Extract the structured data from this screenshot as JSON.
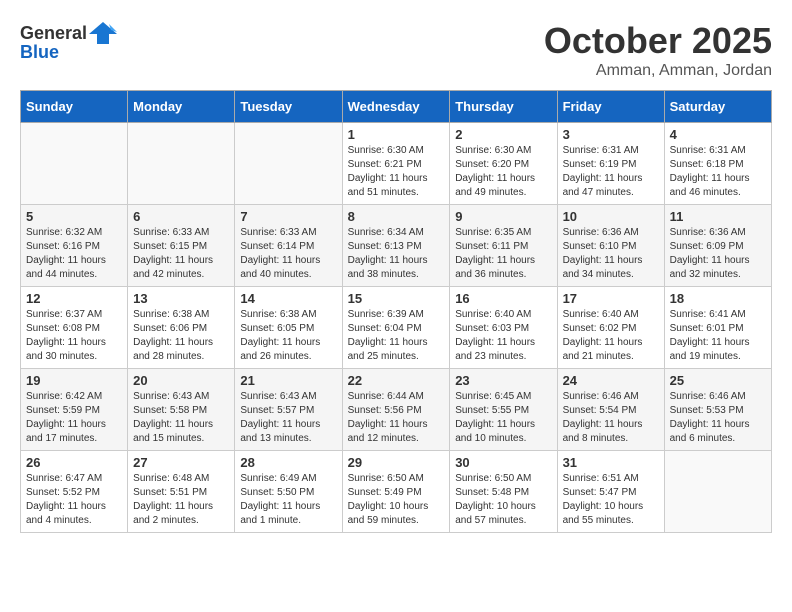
{
  "header": {
    "logo_general": "General",
    "logo_blue": "Blue",
    "month": "October 2025",
    "location": "Amman, Amman, Jordan"
  },
  "weekdays": [
    "Sunday",
    "Monday",
    "Tuesday",
    "Wednesday",
    "Thursday",
    "Friday",
    "Saturday"
  ],
  "weeks": [
    [
      {
        "day": "",
        "info": ""
      },
      {
        "day": "",
        "info": ""
      },
      {
        "day": "",
        "info": ""
      },
      {
        "day": "1",
        "info": "Sunrise: 6:30 AM\nSunset: 6:21 PM\nDaylight: 11 hours\nand 51 minutes."
      },
      {
        "day": "2",
        "info": "Sunrise: 6:30 AM\nSunset: 6:20 PM\nDaylight: 11 hours\nand 49 minutes."
      },
      {
        "day": "3",
        "info": "Sunrise: 6:31 AM\nSunset: 6:19 PM\nDaylight: 11 hours\nand 47 minutes."
      },
      {
        "day": "4",
        "info": "Sunrise: 6:31 AM\nSunset: 6:18 PM\nDaylight: 11 hours\nand 46 minutes."
      }
    ],
    [
      {
        "day": "5",
        "info": "Sunrise: 6:32 AM\nSunset: 6:16 PM\nDaylight: 11 hours\nand 44 minutes."
      },
      {
        "day": "6",
        "info": "Sunrise: 6:33 AM\nSunset: 6:15 PM\nDaylight: 11 hours\nand 42 minutes."
      },
      {
        "day": "7",
        "info": "Sunrise: 6:33 AM\nSunset: 6:14 PM\nDaylight: 11 hours\nand 40 minutes."
      },
      {
        "day": "8",
        "info": "Sunrise: 6:34 AM\nSunset: 6:13 PM\nDaylight: 11 hours\nand 38 minutes."
      },
      {
        "day": "9",
        "info": "Sunrise: 6:35 AM\nSunset: 6:11 PM\nDaylight: 11 hours\nand 36 minutes."
      },
      {
        "day": "10",
        "info": "Sunrise: 6:36 AM\nSunset: 6:10 PM\nDaylight: 11 hours\nand 34 minutes."
      },
      {
        "day": "11",
        "info": "Sunrise: 6:36 AM\nSunset: 6:09 PM\nDaylight: 11 hours\nand 32 minutes."
      }
    ],
    [
      {
        "day": "12",
        "info": "Sunrise: 6:37 AM\nSunset: 6:08 PM\nDaylight: 11 hours\nand 30 minutes."
      },
      {
        "day": "13",
        "info": "Sunrise: 6:38 AM\nSunset: 6:06 PM\nDaylight: 11 hours\nand 28 minutes."
      },
      {
        "day": "14",
        "info": "Sunrise: 6:38 AM\nSunset: 6:05 PM\nDaylight: 11 hours\nand 26 minutes."
      },
      {
        "day": "15",
        "info": "Sunrise: 6:39 AM\nSunset: 6:04 PM\nDaylight: 11 hours\nand 25 minutes."
      },
      {
        "day": "16",
        "info": "Sunrise: 6:40 AM\nSunset: 6:03 PM\nDaylight: 11 hours\nand 23 minutes."
      },
      {
        "day": "17",
        "info": "Sunrise: 6:40 AM\nSunset: 6:02 PM\nDaylight: 11 hours\nand 21 minutes."
      },
      {
        "day": "18",
        "info": "Sunrise: 6:41 AM\nSunset: 6:01 PM\nDaylight: 11 hours\nand 19 minutes."
      }
    ],
    [
      {
        "day": "19",
        "info": "Sunrise: 6:42 AM\nSunset: 5:59 PM\nDaylight: 11 hours\nand 17 minutes."
      },
      {
        "day": "20",
        "info": "Sunrise: 6:43 AM\nSunset: 5:58 PM\nDaylight: 11 hours\nand 15 minutes."
      },
      {
        "day": "21",
        "info": "Sunrise: 6:43 AM\nSunset: 5:57 PM\nDaylight: 11 hours\nand 13 minutes."
      },
      {
        "day": "22",
        "info": "Sunrise: 6:44 AM\nSunset: 5:56 PM\nDaylight: 11 hours\nand 12 minutes."
      },
      {
        "day": "23",
        "info": "Sunrise: 6:45 AM\nSunset: 5:55 PM\nDaylight: 11 hours\nand 10 minutes."
      },
      {
        "day": "24",
        "info": "Sunrise: 6:46 AM\nSunset: 5:54 PM\nDaylight: 11 hours\nand 8 minutes."
      },
      {
        "day": "25",
        "info": "Sunrise: 6:46 AM\nSunset: 5:53 PM\nDaylight: 11 hours\nand 6 minutes."
      }
    ],
    [
      {
        "day": "26",
        "info": "Sunrise: 6:47 AM\nSunset: 5:52 PM\nDaylight: 11 hours\nand 4 minutes."
      },
      {
        "day": "27",
        "info": "Sunrise: 6:48 AM\nSunset: 5:51 PM\nDaylight: 11 hours\nand 2 minutes."
      },
      {
        "day": "28",
        "info": "Sunrise: 6:49 AM\nSunset: 5:50 PM\nDaylight: 11 hours\nand 1 minute."
      },
      {
        "day": "29",
        "info": "Sunrise: 6:50 AM\nSunset: 5:49 PM\nDaylight: 10 hours\nand 59 minutes."
      },
      {
        "day": "30",
        "info": "Sunrise: 6:50 AM\nSunset: 5:48 PM\nDaylight: 10 hours\nand 57 minutes."
      },
      {
        "day": "31",
        "info": "Sunrise: 6:51 AM\nSunset: 5:47 PM\nDaylight: 10 hours\nand 55 minutes."
      },
      {
        "day": "",
        "info": ""
      }
    ]
  ]
}
